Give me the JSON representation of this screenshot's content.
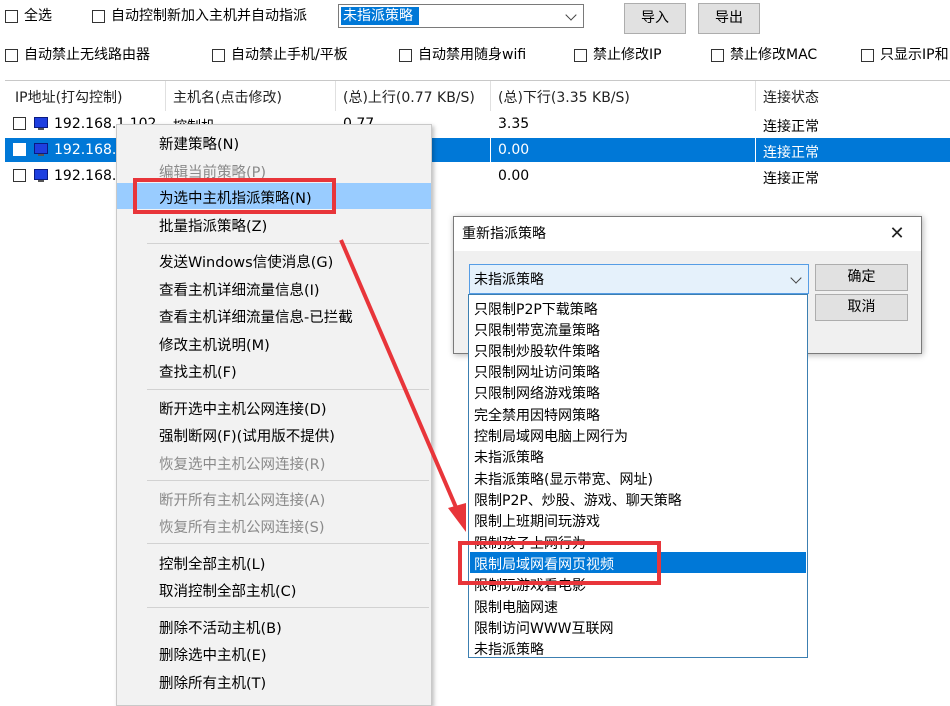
{
  "toolbar": {
    "select_all": "全选",
    "auto_control_label": "自动控制新加入主机并自动指派",
    "policy_combo_value": "未指派策略",
    "import_label": "导入",
    "export_label": "导出"
  },
  "options": {
    "items": [
      "自动禁止无线路由器",
      "自动禁止手机/平板",
      "自动禁用随身wifi",
      "禁止修改IP",
      "禁止修改MAC",
      "只显示IP和"
    ]
  },
  "table": {
    "columns": [
      "IP地址(打勾控制)",
      "主机名(点击修改)",
      "(总)上行(0.77 KB/S)",
      "(总)下行(3.35 KB/S)",
      "连接状态"
    ],
    "rows": [
      {
        "ip": "192.168.1.102",
        "host": "控制机",
        "up": "0.77",
        "down": "3.35",
        "status": "连接正常"
      },
      {
        "ip": "192.168.",
        "host": "",
        "up": "",
        "down": "0.00",
        "status": "连接正常"
      },
      {
        "ip": "192.168.",
        "host": "",
        "up": "",
        "down": "0.00",
        "status": "连接正常"
      }
    ]
  },
  "context_menu": {
    "items": [
      "新建策略(N)",
      "编辑当前策略(P)",
      "为选中主机指派策略(N)",
      "批量指派策略(Z)",
      "发送Windows信使消息(G)",
      "查看主机详细流量信息(I)",
      "查看主机详细流量信息-已拦截",
      "修改主机说明(M)",
      "查找主机(F)",
      "断开选中主机公网连接(D)",
      "强制断网(F)(试用版不提供)",
      "恢复选中主机公网连接(R)",
      "断开所有主机公网连接(A)",
      "恢复所有主机公网连接(S)",
      "控制全部主机(L)",
      "取消控制全部主机(C)",
      "删除不活动主机(B)",
      "删除选中主机(E)",
      "删除所有主机(T)"
    ]
  },
  "dialog": {
    "title": "重新指派策略",
    "combo_value": "未指派策略",
    "ok_label": "确定",
    "cancel_label": "取消",
    "options": [
      "只限制P2P下载策略",
      "只限制带宽流量策略",
      "只限制炒股软件策略",
      "只限制网址访问策略",
      "只限制网络游戏策略",
      "完全禁用因特网策略",
      "控制局域网电脑上网行为",
      "未指派策略",
      "未指派策略(显示带宽、网址)",
      "限制P2P、炒股、游戏、聊天策略",
      "限制上班期间玩游戏",
      "限制孩子上网行为",
      "限制局域网看网页视频",
      "限制玩游戏看电影",
      "限制电脑网速",
      "限制访问WWW互联网",
      "未指派策略"
    ],
    "selected_option": "限制局域网看网页视频"
  },
  "colors": {
    "selection": "#0078d7",
    "menu_highlight": "#99ccff",
    "annotation_red": "#e8353a"
  }
}
